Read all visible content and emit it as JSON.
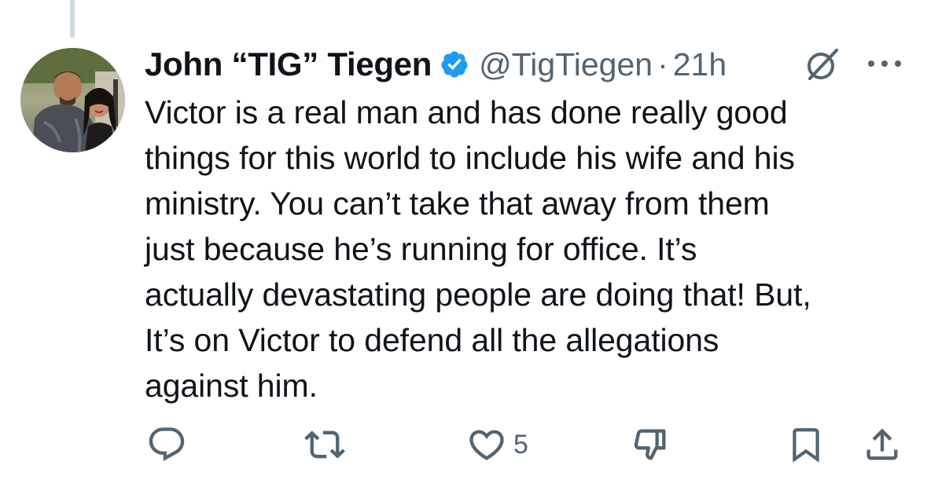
{
  "tweet": {
    "display_name": "John “TIG” Tiegen",
    "handle": "@TigTiegen",
    "separator": "·",
    "time": "21h",
    "verified": true,
    "text": "Victor is a real man and has done really good\nthings for this world to include his wife and his\nministry. You can’t take that away from them\njust because he’s running for office. It’s\nactually devastating people are doing that! But,\nIt’s on Victor to defend all the allegations\nagainst him."
  },
  "actions": {
    "reply_icon": "reply-icon",
    "retweet_icon": "retweet-icon",
    "like_icon": "heart-icon",
    "like_count": "5",
    "dislike_icon": "thumbs-down-icon",
    "bookmark_icon": "bookmark-icon",
    "share_icon": "share-icon"
  },
  "colors": {
    "verified_badge": "#1d9bf0",
    "secondary_text": "#536471",
    "primary_text": "#0f1419",
    "thread_line": "#cfd9de"
  }
}
